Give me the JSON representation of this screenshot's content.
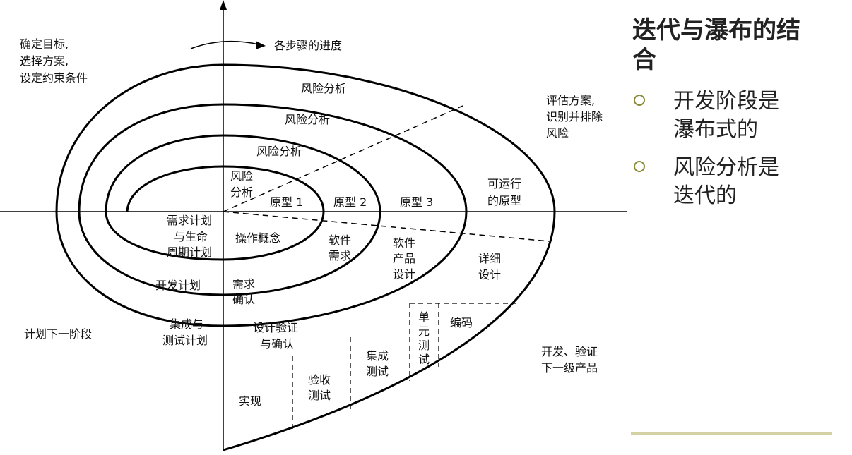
{
  "slide": {
    "title": "迭代与瀑布的结合",
    "bullets": [
      {
        "text": "开发阶段是瀑布式的"
      },
      {
        "text": "风险分析是迭代的"
      }
    ]
  },
  "diagram": {
    "quadrants": {
      "top_left": [
        "确定目标,",
        "选择方案,",
        "设定约束条件"
      ],
      "top_right": [
        "评估方案,",
        "识别并排除",
        "风险"
      ],
      "bottom_left": "计划下一阶段",
      "bottom_right": [
        "开发、验证",
        "下一级产品"
      ]
    },
    "progress_label": "各步骤的进度",
    "risk_analysis": [
      "风险分析",
      "风险分析",
      "风险分析"
    ],
    "innermost_risk": [
      "风险",
      "分析"
    ],
    "prototypes": [
      "原型 1",
      "原型 2",
      "原型 3"
    ],
    "operational_prototype": [
      "可运行",
      "的原型"
    ],
    "plans": {
      "requirements_plan": [
        "需求计划",
        "与生命",
        "周期计划"
      ],
      "development_plan": "开发计划",
      "integration_plan": [
        "集成与",
        "测试计划"
      ]
    },
    "activities": {
      "concept_of_operation": "操作概念",
      "software_requirements": [
        "软件",
        "需求"
      ],
      "product_design": [
        "软件",
        "产品",
        "设计"
      ],
      "detailed_design": [
        "详细",
        "设计"
      ],
      "requirements_validation": [
        "需求",
        "确认"
      ],
      "design_verification": [
        "设计验证",
        "与确认"
      ],
      "coding": "编码",
      "unit_test": [
        "单",
        "元",
        "测",
        "试"
      ],
      "integration_test": [
        "集成",
        "测试"
      ],
      "acceptance_test": [
        "验收",
        "测试"
      ],
      "implementation": "实现"
    }
  },
  "colors": {
    "bullet_marker": "#8a8a38",
    "footer_rule": "#d4d1a4",
    "text": "#222222"
  }
}
